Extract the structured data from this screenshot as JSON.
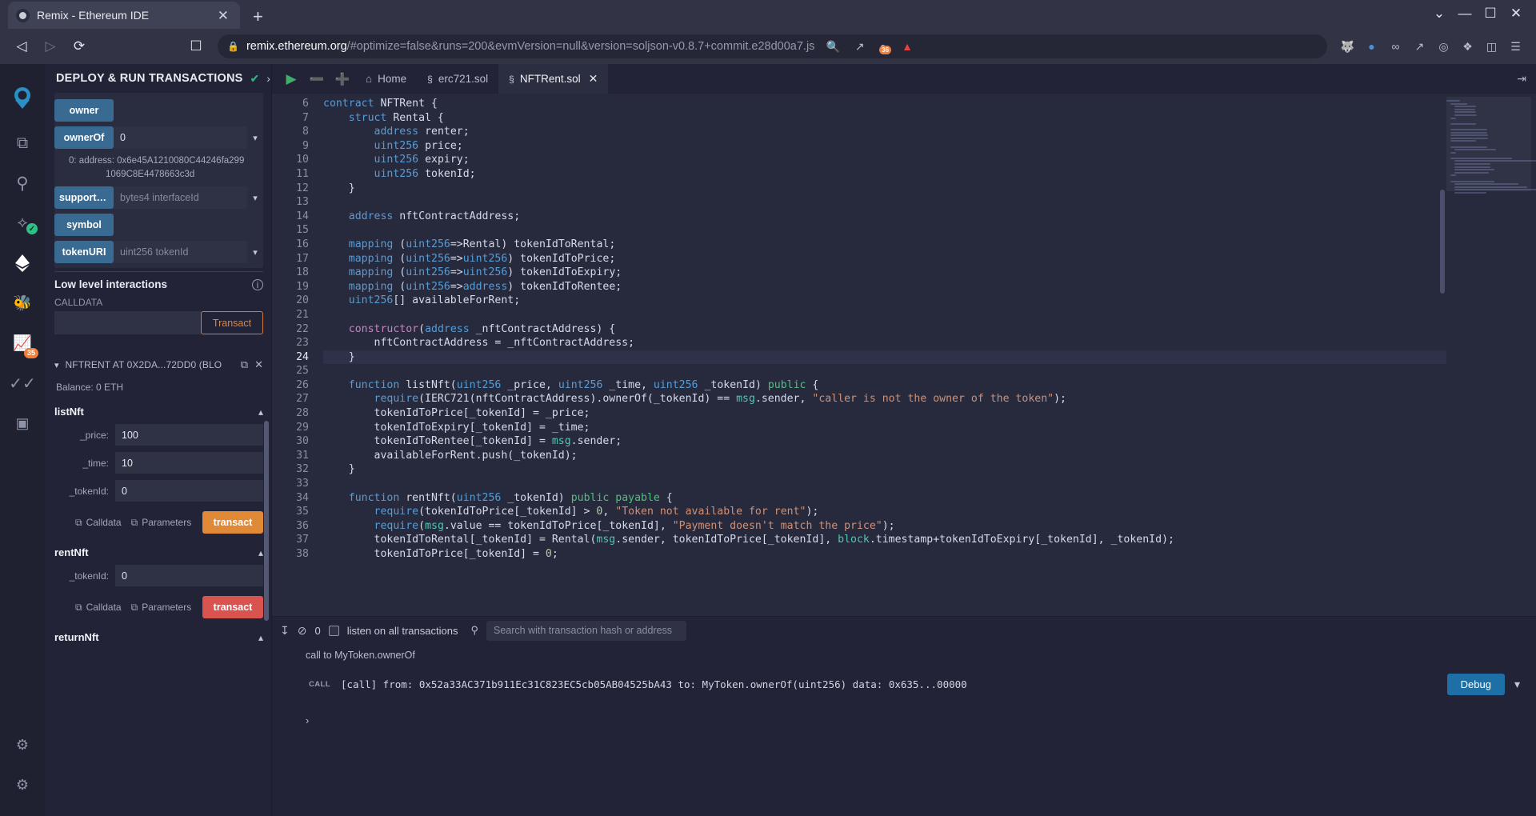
{
  "browser": {
    "tab": {
      "title": "Remix - Ethereum IDE",
      "favicon_name": "remix-favicon",
      "close_label": "✕"
    },
    "new_tab_label": "+",
    "nav": {
      "back": "◁",
      "forward": "▷",
      "reload": "⟳",
      "bookmark": "☐"
    },
    "url": {
      "lock": "🔒",
      "host": "remix.ethereum.org",
      "path": "/#optimize=false&runs=200&evmVersion=null&version=soljson-v0.8.7+commit.e28d00a7.js"
    },
    "url_icons": {
      "zoom": "🔍",
      "share": "↗"
    },
    "extensions": [
      {
        "name": "metamask-fox-icon",
        "glyph": "🦊",
        "badge": ""
      },
      {
        "name": "shield-icon",
        "glyph": "●",
        "badge": "36"
      },
      {
        "name": "avalanche-icon",
        "glyph": "▲",
        "badge": ""
      }
    ],
    "toolbar_right": [
      {
        "name": "fox-icon",
        "glyph": "🦊"
      },
      {
        "name": "circle-blue-icon",
        "glyph": "●"
      },
      {
        "name": "link-icon",
        "glyph": "∞"
      },
      {
        "name": "chart-icon",
        "glyph": "↗"
      },
      {
        "name": "glasses-icon",
        "glyph": "◎"
      },
      {
        "name": "puzzle-icon",
        "glyph": "❖"
      },
      {
        "name": "sidebar-icon",
        "glyph": "◫"
      },
      {
        "name": "menu-icon",
        "glyph": "☰"
      }
    ],
    "window": {
      "minimize": "—",
      "maximize": "☐",
      "close": "✕",
      "chevron": "⌄"
    }
  },
  "rail": {
    "items": [
      {
        "name": "remix-logo",
        "glyph": "◆",
        "badge": "",
        "check": false
      },
      {
        "name": "file-explorer-icon",
        "glyph": "⧉",
        "badge": "",
        "check": false
      },
      {
        "name": "search-icon",
        "glyph": "⚲",
        "badge": "",
        "check": false
      },
      {
        "name": "solidity-compiler-icon",
        "glyph": "⬡",
        "badge": "",
        "check": true
      },
      {
        "name": "deploy-run-icon",
        "glyph": "❖",
        "badge": "",
        "check": false
      },
      {
        "name": "debugger-icon",
        "glyph": "⚙",
        "badge": "",
        "check": false
      },
      {
        "name": "analysis-icon",
        "glyph": "↗",
        "badge": "35",
        "check": false
      },
      {
        "name": "testing-icon",
        "glyph": "»",
        "badge": "",
        "check": false
      },
      {
        "name": "plugin-manager-icon",
        "glyph": "▣",
        "badge": "",
        "check": false
      }
    ],
    "bottom": [
      {
        "name": "plugin-icon",
        "glyph": "☁"
      },
      {
        "name": "settings-gear-icon",
        "glyph": "⚙"
      }
    ]
  },
  "sidepanel": {
    "title": "DEPLOY & RUN TRANSACTIONS",
    "header_check": "✔",
    "header_chevron": "›",
    "functions": [
      {
        "name": "owner",
        "label": "owner",
        "placeholder": "",
        "value": "",
        "has_caret": false
      },
      {
        "name": "ownerOf",
        "label": "ownerOf",
        "placeholder": "",
        "value": "0",
        "has_caret": true
      },
      {
        "name": "supportsInterface",
        "label": "supportsIn...",
        "placeholder": "bytes4 interfaceId",
        "value": "",
        "has_caret": true
      },
      {
        "name": "symbol",
        "label": "symbol",
        "placeholder": "",
        "value": "",
        "has_caret": false
      },
      {
        "name": "tokenURI",
        "label": "tokenURI",
        "placeholder": "uint256 tokenId",
        "value": "",
        "has_caret": true
      }
    ],
    "ownerOf_result": {
      "index": "0:",
      "label": "address:",
      "value_line1": "0x6e45A1210080C44246fa299",
      "value_line2": "1069C8E4478663c3d"
    },
    "low_level": {
      "title": "Low level interactions",
      "info_icon": "i",
      "calldata_label": "CALLDATA",
      "calldata_value": "",
      "calldata_placeholder": "",
      "transact_label": "Transact"
    },
    "deployed": {
      "chevron": "⌄",
      "name": "NFTRENT AT 0X2DA...72DD0 (BLO",
      "copy_icon": "⧉",
      "close_icon": "✕",
      "balance": "Balance: 0 ETH"
    },
    "methods": [
      {
        "name": "listNft",
        "chevron": "⌃",
        "params": [
          {
            "label": "_price:",
            "value": "100"
          },
          {
            "label": "_time:",
            "value": "10"
          },
          {
            "label": "_tokenId:",
            "value": "0"
          }
        ],
        "calldata_label": "Calldata",
        "parameters_label": "Parameters",
        "transact_label": "transact",
        "transact_color": "orange"
      },
      {
        "name": "rentNft",
        "chevron": "⌃",
        "params": [
          {
            "label": "_tokenId:",
            "value": "0"
          }
        ],
        "calldata_label": "Calldata",
        "parameters_label": "Parameters",
        "transact_label": "transact",
        "transact_color": "red"
      },
      {
        "name": "returnNft",
        "chevron": "⌃",
        "params": [],
        "calldata_label": "",
        "parameters_label": "",
        "transact_label": "",
        "transact_color": ""
      }
    ]
  },
  "editor": {
    "toolbar": {
      "run_icon": "▶",
      "zoom_out_icon": "⊖",
      "zoom_in_icon": "⊕",
      "home_icon": "⌂",
      "home_label": "Home",
      "expand_icon": "⇹"
    },
    "tabs": [
      {
        "name": "erc721.sol",
        "label": "erc721.sol",
        "icon": "§",
        "active": false,
        "closable": false
      },
      {
        "name": "NFTRent.sol",
        "label": "NFTRent.sol",
        "icon": "§",
        "active": true,
        "closable": true,
        "close": "✕"
      }
    ],
    "first_line_number": 6,
    "current_line": 24,
    "lines": [
      {
        "n": 6,
        "tokens": [
          {
            "t": "contract ",
            "c": "k"
          },
          {
            "t": "NFTRent {",
            "c": "id"
          }
        ],
        "indent": 0
      },
      {
        "n": 7,
        "tokens": [
          {
            "t": "struct ",
            "c": "k"
          },
          {
            "t": "Rental {",
            "c": "id"
          }
        ],
        "indent": 1
      },
      {
        "n": 8,
        "tokens": [
          {
            "t": "address ",
            "c": "k"
          },
          {
            "t": "renter;",
            "c": "id"
          }
        ],
        "indent": 2
      },
      {
        "n": 9,
        "tokens": [
          {
            "t": "uint256 ",
            "c": "k"
          },
          {
            "t": "price;",
            "c": "id"
          }
        ],
        "indent": 2
      },
      {
        "n": 10,
        "tokens": [
          {
            "t": "uint256 ",
            "c": "k"
          },
          {
            "t": "expiry;",
            "c": "id"
          }
        ],
        "indent": 2
      },
      {
        "n": 11,
        "tokens": [
          {
            "t": "uint256 ",
            "c": "k"
          },
          {
            "t": "tokenId;",
            "c": "id"
          }
        ],
        "indent": 2
      },
      {
        "n": 12,
        "tokens": [
          {
            "t": "}",
            "c": "id"
          }
        ],
        "indent": 1
      },
      {
        "n": 13,
        "tokens": [],
        "indent": 0
      },
      {
        "n": 14,
        "tokens": [
          {
            "t": "address ",
            "c": "k"
          },
          {
            "t": "nftContractAddress;",
            "c": "id"
          }
        ],
        "indent": 1
      },
      {
        "n": 15,
        "tokens": [],
        "indent": 0
      },
      {
        "n": 16,
        "tokens": [
          {
            "t": "mapping ",
            "c": "k"
          },
          {
            "t": "(",
            "c": "id"
          },
          {
            "t": "uint256",
            "c": "k"
          },
          {
            "t": "=>Rental) tokenIdToRental;",
            "c": "id"
          }
        ],
        "indent": 1
      },
      {
        "n": 17,
        "tokens": [
          {
            "t": "mapping ",
            "c": "k"
          },
          {
            "t": "(",
            "c": "id"
          },
          {
            "t": "uint256",
            "c": "k"
          },
          {
            "t": "=>",
            "c": "id"
          },
          {
            "t": "uint256",
            "c": "k"
          },
          {
            "t": ") tokenIdToPrice;",
            "c": "id"
          }
        ],
        "indent": 1
      },
      {
        "n": 18,
        "tokens": [
          {
            "t": "mapping ",
            "c": "k"
          },
          {
            "t": "(",
            "c": "id"
          },
          {
            "t": "uint256",
            "c": "k"
          },
          {
            "t": "=>",
            "c": "id"
          },
          {
            "t": "uint256",
            "c": "k"
          },
          {
            "t": ") tokenIdToExpiry;",
            "c": "id"
          }
        ],
        "indent": 1
      },
      {
        "n": 19,
        "tokens": [
          {
            "t": "mapping ",
            "c": "k"
          },
          {
            "t": "(",
            "c": "id"
          },
          {
            "t": "uint256",
            "c": "k"
          },
          {
            "t": "=>",
            "c": "id"
          },
          {
            "t": "address",
            "c": "k"
          },
          {
            "t": ") tokenIdToRentee;",
            "c": "id"
          }
        ],
        "indent": 1
      },
      {
        "n": 20,
        "tokens": [
          {
            "t": "uint256",
            "c": "k"
          },
          {
            "t": "[] availableForRent;",
            "c": "id"
          }
        ],
        "indent": 1
      },
      {
        "n": 21,
        "tokens": [],
        "indent": 0
      },
      {
        "n": 22,
        "tokens": [
          {
            "t": "constructor",
            "c": "kc"
          },
          {
            "t": "(",
            "c": "id"
          },
          {
            "t": "address",
            "c": "k"
          },
          {
            "t": " _nftContractAddress) {",
            "c": "id"
          }
        ],
        "indent": 1
      },
      {
        "n": 23,
        "tokens": [
          {
            "t": "nftContractAddress = _nftContractAddress;",
            "c": "id"
          }
        ],
        "indent": 2
      },
      {
        "n": 24,
        "tokens": [
          {
            "t": "}",
            "c": "id"
          }
        ],
        "indent": 1
      },
      {
        "n": 25,
        "tokens": [],
        "indent": 0
      },
      {
        "n": 26,
        "tokens": [
          {
            "t": "function ",
            "c": "k"
          },
          {
            "t": "listNft(",
            "c": "id"
          },
          {
            "t": "uint256",
            "c": "k"
          },
          {
            "t": " _price, ",
            "c": "id"
          },
          {
            "t": "uint256",
            "c": "k"
          },
          {
            "t": " _time, ",
            "c": "id"
          },
          {
            "t": "uint256",
            "c": "k"
          },
          {
            "t": " _tokenId) ",
            "c": "id"
          },
          {
            "t": "public",
            "c": "mg"
          },
          {
            "t": " {",
            "c": "id"
          }
        ],
        "indent": 1
      },
      {
        "n": 27,
        "tokens": [
          {
            "t": "require",
            "c": "k"
          },
          {
            "t": "(IERC721(nftContractAddress).ownerOf(_tokenId) == ",
            "c": "id"
          },
          {
            "t": "msg",
            "c": "g"
          },
          {
            "t": ".sender, ",
            "c": "id"
          },
          {
            "t": "\"caller is not the owner of the token\"",
            "c": "s"
          },
          {
            "t": ");",
            "c": "id"
          }
        ],
        "indent": 2
      },
      {
        "n": 28,
        "tokens": [
          {
            "t": "tokenIdToPrice[_tokenId] = _price;",
            "c": "id"
          }
        ],
        "indent": 2
      },
      {
        "n": 29,
        "tokens": [
          {
            "t": "tokenIdToExpiry[_tokenId] = _time;",
            "c": "id"
          }
        ],
        "indent": 2
      },
      {
        "n": 30,
        "tokens": [
          {
            "t": "tokenIdToRentee[_tokenId] = ",
            "c": "id"
          },
          {
            "t": "msg",
            "c": "g"
          },
          {
            "t": ".sender;",
            "c": "id"
          }
        ],
        "indent": 2
      },
      {
        "n": 31,
        "tokens": [
          {
            "t": "availableForRent.push(_tokenId);",
            "c": "id"
          }
        ],
        "indent": 2
      },
      {
        "n": 32,
        "tokens": [
          {
            "t": "}",
            "c": "id"
          }
        ],
        "indent": 1
      },
      {
        "n": 33,
        "tokens": [],
        "indent": 0
      },
      {
        "n": 34,
        "tokens": [
          {
            "t": "function ",
            "c": "k"
          },
          {
            "t": "rentNft(",
            "c": "id"
          },
          {
            "t": "uint256",
            "c": "k"
          },
          {
            "t": " _tokenId) ",
            "c": "id"
          },
          {
            "t": "public payable",
            "c": "mg"
          },
          {
            "t": " {",
            "c": "id"
          }
        ],
        "indent": 1
      },
      {
        "n": 35,
        "tokens": [
          {
            "t": "require",
            "c": "k"
          },
          {
            "t": "(tokenIdToPrice[_tokenId] > ",
            "c": "id"
          },
          {
            "t": "0",
            "c": "n"
          },
          {
            "t": ", ",
            "c": "id"
          },
          {
            "t": "\"Token not available for rent\"",
            "c": "s"
          },
          {
            "t": ");",
            "c": "id"
          }
        ],
        "indent": 2
      },
      {
        "n": 36,
        "tokens": [
          {
            "t": "require",
            "c": "k"
          },
          {
            "t": "(",
            "c": "id"
          },
          {
            "t": "msg",
            "c": "g"
          },
          {
            "t": ".value == tokenIdToPrice[_tokenId], ",
            "c": "id"
          },
          {
            "t": "\"Payment doesn't match the price\"",
            "c": "s"
          },
          {
            "t": ");",
            "c": "id"
          }
        ],
        "indent": 2
      },
      {
        "n": 37,
        "tokens": [
          {
            "t": "tokenIdToRental[_tokenId] = Rental(",
            "c": "id"
          },
          {
            "t": "msg",
            "c": "g"
          },
          {
            "t": ".sender, tokenIdToPrice[_tokenId], ",
            "c": "id"
          },
          {
            "t": "block",
            "c": "g"
          },
          {
            "t": ".timestamp+tokenIdToExpiry[_tokenId], _tokenId);",
            "c": "id"
          }
        ],
        "indent": 2
      },
      {
        "n": 38,
        "tokens": [
          {
            "t": "tokenIdToPrice[_tokenId] = ",
            "c": "id"
          },
          {
            "t": "0",
            "c": "n"
          },
          {
            "t": ";",
            "c": "id"
          }
        ],
        "indent": 2
      }
    ]
  },
  "terminal": {
    "toolbar": {
      "collapse_icon": "↧",
      "clear_icon": "⊘",
      "count": "0",
      "checkbox_checked": false,
      "listen_label": "listen on all transactions",
      "search_icon": "⚲",
      "search_placeholder": "Search with transaction hash or address",
      "search_value": ""
    },
    "log_line": "call to MyToken.ownerOf",
    "transaction": {
      "tag": "CALL",
      "text": "[call] from: 0x52a33AC371b911Ec31C823EC5cb05AB04525bA43 to: MyToken.ownerOf(uint256) data: 0x635...00000",
      "debug_label": "Debug",
      "chevron": "⌄"
    },
    "prompt": "›"
  },
  "colors": {
    "accent_orange": "#e08a37",
    "accent_red": "#d9534f",
    "accent_blue": "#386a92",
    "debug_blue": "#1d6fa5",
    "success_green": "#2fc08a",
    "bg": "#222336",
    "editor_bg": "#272a3d"
  }
}
